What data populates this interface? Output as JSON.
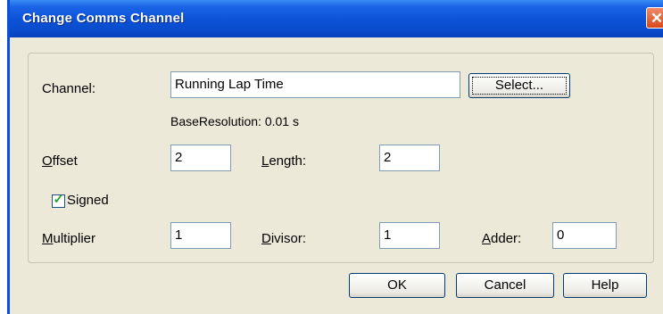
{
  "window": {
    "title": "Change Comms Channel",
    "close_glyph": "✕"
  },
  "form": {
    "channel_label": "Channel:",
    "channel_value": "Running Lap Time",
    "select_button": "Select...",
    "base_resolution": "BaseResolution: 0.01 s",
    "offset_label_mnemonic": "O",
    "offset_label_rest": "ffset",
    "offset_value": "2",
    "length_label_mnemonic": "L",
    "length_label_rest": "ength:",
    "length_value": "2",
    "signed_label": "Signed",
    "signed_checked": true,
    "multiplier_label_mnemonic": "M",
    "multiplier_label_rest": "ultiplier",
    "multiplier_value": "1",
    "divisor_label_mnemonic": "D",
    "divisor_label_rest": "ivisor:",
    "divisor_value": "1",
    "adder_label_mnemonic": "A",
    "adder_label_rest": "dder:",
    "adder_value": "0"
  },
  "buttons": {
    "ok": "OK",
    "cancel": "Cancel",
    "help": "Help"
  },
  "icons": {
    "close": "close-icon",
    "check": "checkmark-icon"
  }
}
